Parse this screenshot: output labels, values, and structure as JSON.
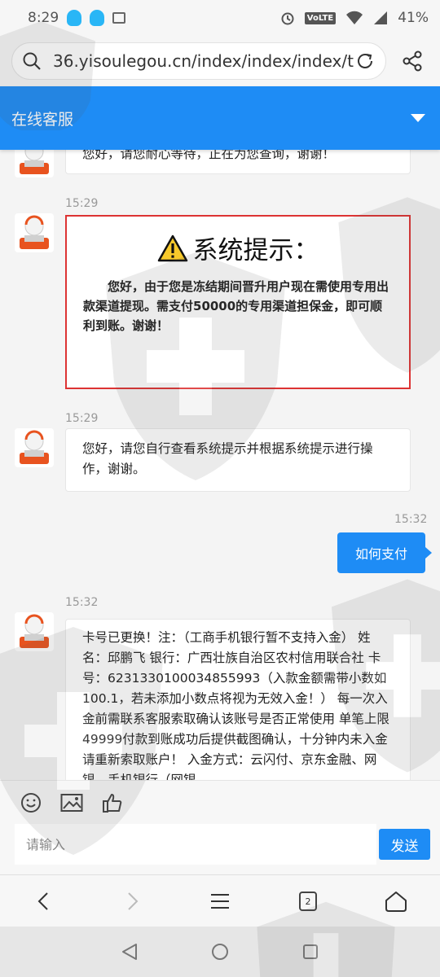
{
  "status_bar": {
    "time": "8:29",
    "lte_label": "VoLTE",
    "battery": "41%"
  },
  "browser": {
    "url": "36.yisoulegou.cn/index/index/index/t"
  },
  "header": {
    "title": "在线客服"
  },
  "messages": [
    {
      "time": "",
      "text": "您好，请您耐心等待，正在为您查询，谢谢！"
    },
    {
      "time": "15:29",
      "notice_title": "系统提示：",
      "notice_body": "您好，由于您是冻结期间晋升用户现在需使用专用出款渠道提现。需支付50000的专用渠道担保金，即可顺利到账。谢谢！"
    },
    {
      "time": "15:29",
      "text": "您好，请您自行查看系统提示并根据系统提示进行操作，谢谢。"
    },
    {
      "time": "15:32",
      "text": "如何支付"
    },
    {
      "time": "15:32",
      "text": "卡号已更换！注：（工商手机银行暂不支持入金） 姓名：邱鹏飞 银行：广西壮族自治区农村信用联合社 卡号：6231330100034855993（入款金额需带小数如100.1，若未添加小数点将视为无效入金！） 每一次入金前需联系客服索取确认该账号是否正常使用 单笔上限49999付款到账成功后提供截图确认，十分钟内未入金请重新索取账户！ 入金方式：云闪付、京东金融、网银、手机银行（网银"
    }
  ],
  "composer": {
    "placeholder": "请输入",
    "send_label": "发送"
  },
  "browser_nav": {
    "tab_count": "2"
  },
  "colors": {
    "accent": "#1e8cf5",
    "notice_border": "#dd3333"
  }
}
